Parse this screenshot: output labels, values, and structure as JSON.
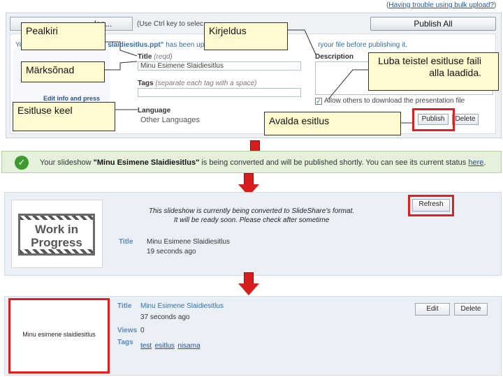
{
  "upload_form": {
    "help_link_prefix": "(",
    "help_link": "Having trouble using bulk upload?",
    "help_link_suffix": ")",
    "browse_button": "les...",
    "hint": "(Use Ctrl key to selec",
    "publish_all": "Publish All",
    "message_prefix": "Yo",
    "message_file": "slaidiesitlus.ppt\"",
    "message_rest": "has been uploaded",
    "message_tail": "ryour file before publishing it.",
    "title_label": "Title",
    "title_req": "(reqd)",
    "title_value": "Minu Esimene Slaidiesitlus",
    "tags_label": "Tags",
    "tags_hint": "(separate each tag with a space)",
    "description_label": "Description",
    "edit_link": "Edit info and press",
    "language_label": "Language",
    "language_value": "Other Languages",
    "allow_download": "Allow others to download the presentation file",
    "publish_button": "Publish",
    "delete_button": "Delete"
  },
  "callouts": {
    "title": "Pealkiri",
    "description": "Kirjeldus",
    "tags": "Märksõnad",
    "allow_download": "Luba teistel esitluse faili alla laadida.",
    "language": "Esitluse keel",
    "publish": "Avalda esitlus"
  },
  "success_bar": {
    "prefix": "Your slideshow",
    "title": "\"Minu Esimene Slaidiesitlus\"",
    "middle": "is being converted and will be published shortly. You can see its current status",
    "link": "here",
    "suffix": "."
  },
  "converting": {
    "image_line1": "Work in",
    "image_line2": "Progress",
    "line1": "This slideshow is currently being converted to SlideShare's format.",
    "line2": "It will be ready soon. Please check after sometime",
    "refresh_button": "Refresh",
    "title_label": "Title",
    "title_value": "Minu Esimene Slaidiesitlus",
    "time": "19 seconds ago"
  },
  "published": {
    "thumb_text": "Minu esimene slaidiesitlus",
    "title_label": "Title",
    "title_value": "Minu Esimene Slaidiesitlus",
    "time": "37 seconds ago",
    "views_label": "Views",
    "views_value": "0",
    "tags_label": "Tags",
    "tags": [
      "test",
      "esitlus",
      "nisama"
    ],
    "edit_button": "Edit",
    "delete_button": "Delete"
  },
  "colors": {
    "callout_bg": "#fffad0",
    "highlight_red": "#e02020",
    "arrow_red": "#d71d1d",
    "success_bg": "#e6f1dc",
    "link_blue": "#1f55a0"
  }
}
